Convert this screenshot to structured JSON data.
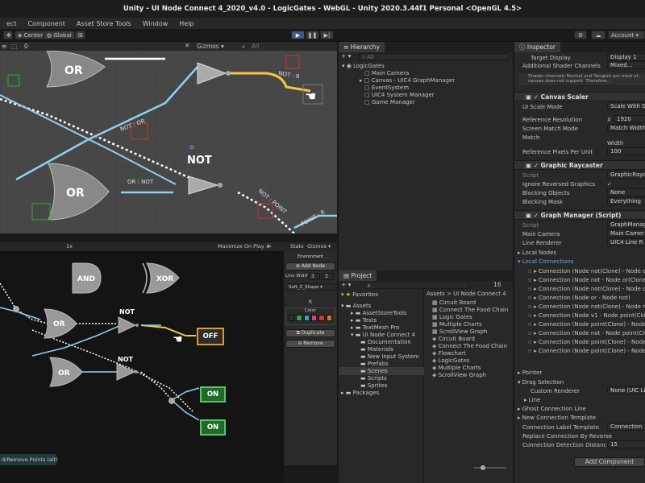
{
  "title": "Unity - UI Node Connect 4_2020_v4.0 - LogicGates - WebGL - Unity 2020.3.44f1 Personal <OpenGL 4.5>",
  "menu": [
    "ect",
    "Component",
    "Asset Store Tools",
    "Window",
    "Help"
  ],
  "toolbar": {
    "center": "Center",
    "global": "Global",
    "account": "Account"
  },
  "scene": {
    "gizmos": "Gizmos",
    "all": "All",
    "toolbar_zero": "0",
    "labels": [
      "OR",
      "NOT",
      "OR",
      "NOT"
    ],
    "conn_labels": [
      "NOT : R",
      "NOT : OR",
      "OR : NOT",
      "NOT : POINT",
      "POINT : R"
    ]
  },
  "game": {
    "scale": "1x",
    "maximize": "Maximize On Play",
    "stats": "Stats",
    "gizmos": "Gizmos",
    "gates": [
      "AND",
      "XOR",
      "OR",
      "NOT",
      "OR",
      "NOT"
    ],
    "outputs": {
      "off": "OFF",
      "on1": "ON",
      "on2": "ON"
    },
    "hint": "d/Remove Points (alt)",
    "side": {
      "environment": "Environment",
      "add_node": "Add Node",
      "line_width": "Line Width",
      "lw1": "3",
      "lw2": "3",
      "shape": "Soft_Z_Shape",
      "r": "R",
      "color": "Color",
      "duplicate": "Duplicate",
      "remove": "Remove"
    },
    "swatches": [
      "#303030",
      "#2ea44f",
      "#3aa0c8",
      "#e03c8c",
      "#c83a3a",
      "#e0702a"
    ]
  },
  "hierarchy": {
    "tab": "Hierarchy",
    "search": "All",
    "items": [
      "LogicGates",
      "Main Camera",
      "Canvas - UIC4 GraphManager",
      "EventSystem",
      "UIC4 System Manager",
      "Game Manager"
    ]
  },
  "project": {
    "tab": "Project",
    "count": "16",
    "favorites": "Favorites",
    "assets": "Assets",
    "packages": "Packages",
    "tree": [
      "AssetStoreTools",
      "Tests",
      "TextMesh Pro",
      "UI Node Connect 4",
      "Documentation",
      "Materials",
      "New Input System",
      "Prefabs",
      "Scenes",
      "Scripts",
      "Sprites"
    ],
    "breadcrumb": [
      "Assets",
      "UI Node Connect 4"
    ],
    "files": [
      "Circuit Board",
      "Connect The Food Chain",
      "Logic Gates",
      "Multiple Charts",
      "ScrollView Graph",
      "Circuit Board",
      "Connect The Food Chain",
      "Flowchart",
      "LogicGates",
      "Multiple Charts",
      "ScrollView Graph"
    ]
  },
  "inspector": {
    "tab": "Inspector",
    "target_display_label": "Target Display",
    "target_display": "Display 1",
    "shader_label": "Additional Shader Channels",
    "shader": "Mixed...",
    "warning": "Shader channels Normal and Tangent are most of... canvas does not support. Therefore...",
    "canvas_scaler": "Canvas Scaler",
    "ui_scale_mode_label": "UI Scale Mode",
    "ui_scale_mode": "Scale With Sc",
    "ref_res_label": "Reference Resolution",
    "ref_x": "X",
    "ref_x_val": "1920",
    "screen_match_label": "Screen Match Mode",
    "screen_match": "Match Width C",
    "match_label": "Match",
    "width": "Width",
    "ppu_label": "Reference Pixels Per Unit",
    "ppu": "100",
    "graphic_raycaster": "Graphic Raycaster",
    "script_label": "Script",
    "script_raycaster": "GraphicRayc",
    "ignore_reversed": "Ignore Reversed Graphics",
    "blocking_objects_label": "Blocking Objects",
    "blocking_objects": "None",
    "blocking_mask_label": "Blocking Mask",
    "blocking_mask": "Everything",
    "graph_manager": "Graph Manager (Script)",
    "script_graph": "GraphManager",
    "main_camera_label": "Main Camera",
    "main_camera": "Main Camer",
    "line_renderer_label": "Line Renderer",
    "line_renderer": "UIC4 Line R",
    "local_nodes": "Local Nodes",
    "local_connections": "Local Connections",
    "connections": [
      "Connection (Node not(Clone) - Node or)",
      "Connection (Node not - Node or(Clone))",
      "Connection (Node not(Clone) - Node or(Clon",
      "Connection (Node or - Node not)",
      "Connection (Node not(Clone) - Node result)",
      "Connection (Node v1 - Node point(Clone))",
      "Connection (Node point(Clone) - Node or)",
      "Connection (Node not - Node point(Clone))",
      "Connection (Node point(Clone) - Node resul",
      "Connection (Node point(Clone) - Node resul"
    ],
    "pointer": "Pointer",
    "drag_selection": "Drag Selection",
    "custom_renderer_label": "Custom Renderer",
    "custom_renderer": "None (UIC Line",
    "line": "Line",
    "ghost_connection": "Ghost Connection Line",
    "new_connection_template": "New Connection Template",
    "label_template_label": "Connection Label Template",
    "label_template": "Connection",
    "replace_reverse": "Replace Connection By Reverse",
    "detection_distance_label": "Connection Detection Distance",
    "detection_distance": "15",
    "add_component": "Add Component"
  }
}
